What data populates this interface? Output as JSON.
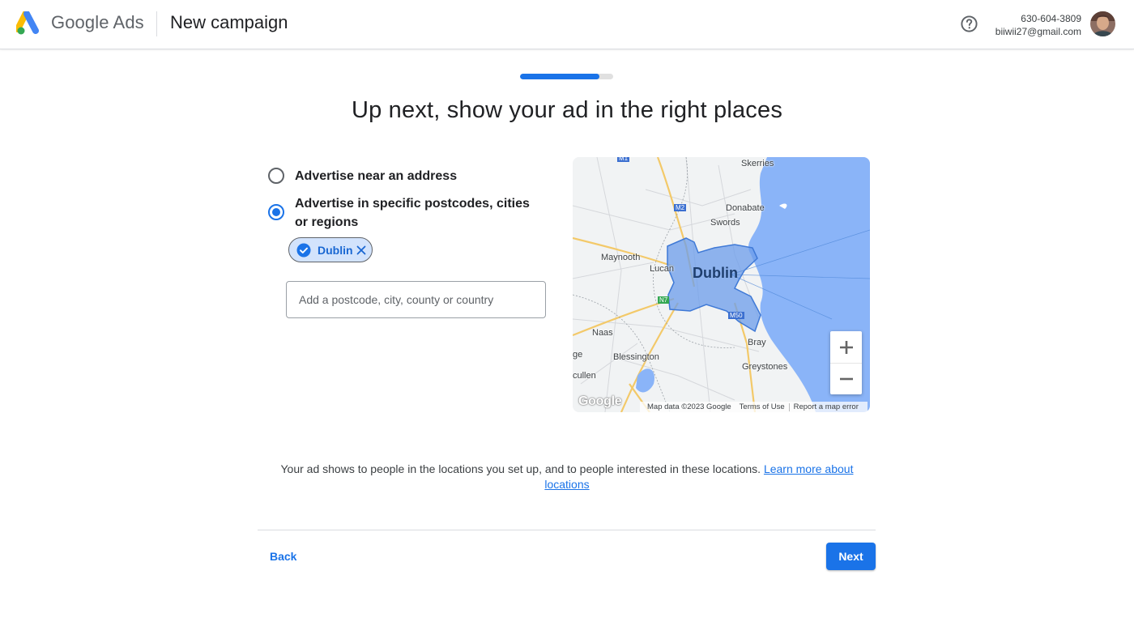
{
  "header": {
    "brand": "Google Ads",
    "page_title": "New campaign",
    "help_icon": "help-circle-icon",
    "account_phone": "630-604-3809",
    "account_email": "biiwii27@gmail.com"
  },
  "progress": {
    "value": 0.85
  },
  "heading": "Up next, show your ad in the right places",
  "options": {
    "near_address": {
      "label": "Advertise near an address",
      "selected": false
    },
    "specific_regions": {
      "label": "Advertise in specific postcodes, cities or regions",
      "selected": true
    }
  },
  "selected_locations": [
    {
      "label": "Dublin",
      "icon": "check-circle-icon"
    }
  ],
  "location_input": {
    "placeholder": "Add a postcode, city, county or country",
    "value": ""
  },
  "map": {
    "labels": {
      "skerries": "Skerries",
      "donabate": "Donabate",
      "swords": "Swords",
      "maynooth": "Maynooth",
      "lucan": "Lucan",
      "dublin": "Dublin",
      "naas": "Naas",
      "blessington": "Blessington",
      "bray": "Bray",
      "greystones": "Greystones",
      "ge": "ge",
      "cullen": "cullen",
      "m2": "M2",
      "m50": "M50",
      "m1": "M1",
      "n7": "N7"
    },
    "watermark": "Google",
    "map_data": "Map data ©2023 Google",
    "terms": "Terms of Use",
    "report": "Report a map error",
    "zoom_in": "+",
    "zoom_out": "−"
  },
  "info": {
    "text": "Your ad shows to people in the locations you set up, and to people interested in these locations.",
    "link_part1": "Learn more about",
    "link_part2": "locations"
  },
  "footer": {
    "back_label": "Back",
    "next_label": "Next"
  },
  "colors": {
    "accent": "#1a73e8",
    "chip_bg": "#d2e3fc",
    "water": "#8ab4f8",
    "region": "#6b9ceb"
  }
}
